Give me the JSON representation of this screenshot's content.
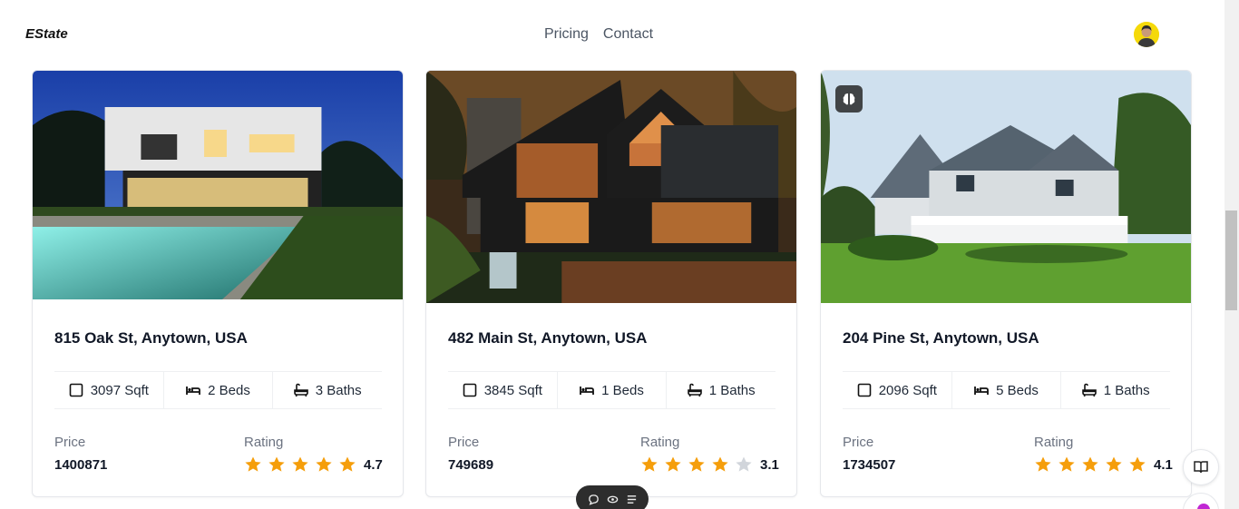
{
  "header": {
    "brand": "EState",
    "nav": [
      "Pricing",
      "Contact"
    ]
  },
  "colors": {
    "star_filled": "#f59e0b",
    "star_empty": "#d1d5db",
    "text_primary": "#111827",
    "text_muted": "#6b7280"
  },
  "labels": {
    "price": "Price",
    "rating": "Rating"
  },
  "cards": [
    {
      "address": "815 Oak St, Anytown, USA",
      "sqft": "3097 Sqft",
      "beds": "2 Beds",
      "baths": "3 Baths",
      "price": "1400871",
      "rating": "4.7",
      "stars_filled": 5
    },
    {
      "address": "482 Main St, Anytown, USA",
      "sqft": "3845 Sqft",
      "beds": "1 Beds",
      "baths": "1 Baths",
      "price": "749689",
      "rating": "3.1",
      "stars_filled": 4
    },
    {
      "address": "204 Pine St, Anytown, USA",
      "sqft": "2096 Sqft",
      "beds": "5 Beds",
      "baths": "1 Baths",
      "price": "1734507",
      "rating": "4.1",
      "stars_filled": 5
    }
  ],
  "icons": {
    "sqft": "square-icon",
    "beds": "bed-icon",
    "baths": "bath-icon",
    "star": "star-icon",
    "ai_badge": "brain-icon",
    "book": "book-icon"
  }
}
